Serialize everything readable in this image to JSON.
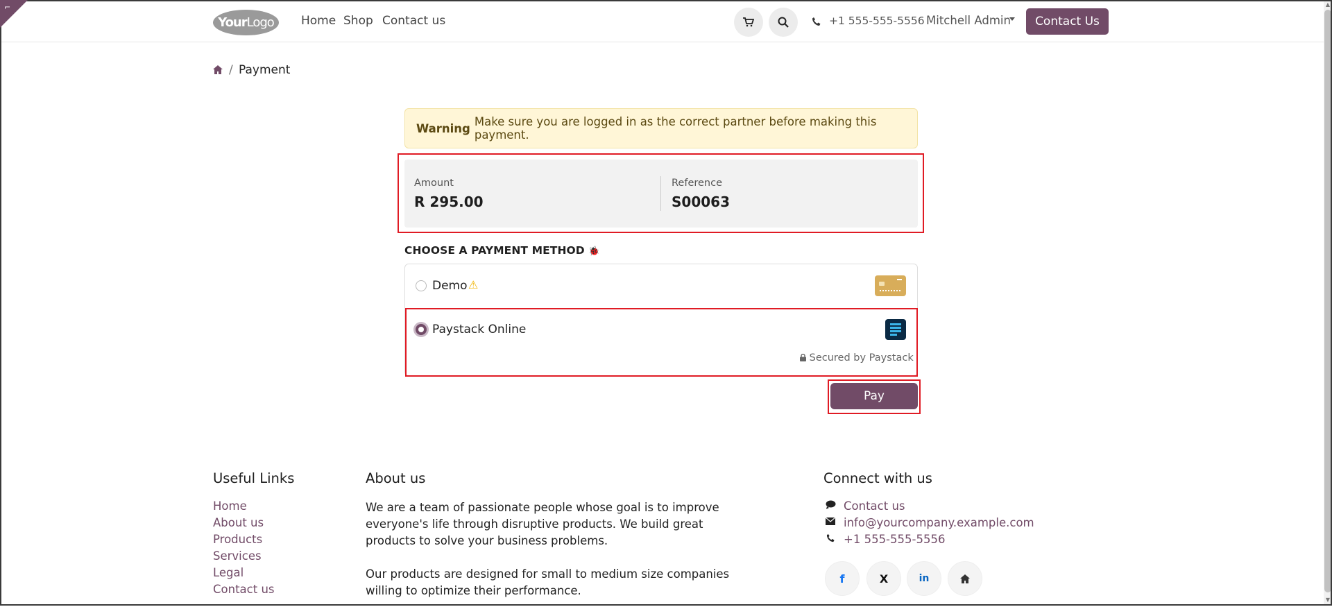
{
  "header": {
    "logo_main": "Your",
    "logo_sub": "Logo",
    "nav": [
      "Home",
      "Shop",
      "Contact us"
    ],
    "phone": "+1 555-555-5556",
    "user": "Mitchell Admin",
    "contact_button": "Contact Us"
  },
  "breadcrumb": {
    "current": "Payment"
  },
  "warning": {
    "title": "Warning",
    "text": "Make sure you are logged in as the correct partner before making this payment."
  },
  "summary": {
    "amount_label": "Amount",
    "amount_value": "R 295.00",
    "reference_label": "Reference",
    "reference_value": "S00063"
  },
  "payment": {
    "heading": "CHOOSE A PAYMENT METHOD",
    "methods": [
      {
        "label": "Demo",
        "selected": false
      },
      {
        "label": "Paystack Online",
        "selected": true
      }
    ],
    "secured_text": "Secured by Paystack",
    "pay_button": "Pay"
  },
  "footer": {
    "useful_links_title": "Useful Links",
    "useful_links": [
      "Home",
      "About us",
      "Products",
      "Services",
      "Legal",
      "Contact us"
    ],
    "about_title": "About us",
    "about_p1": "We are a team of passionate people whose goal is to improve everyone's life through disruptive products. We build great products to solve your business problems.",
    "about_p2": "Our products are designed for small to medium size companies willing to optimize their performance.",
    "connect_title": "Connect with us",
    "connect": [
      "Contact us",
      "info@yourcompany.example.com",
      "+1 555-555-5556"
    ],
    "social": [
      "f",
      "X",
      "in"
    ]
  },
  "colors": {
    "brand": "#714b67",
    "highlight": "#e01b24",
    "warning_bg": "#fff6d7"
  }
}
